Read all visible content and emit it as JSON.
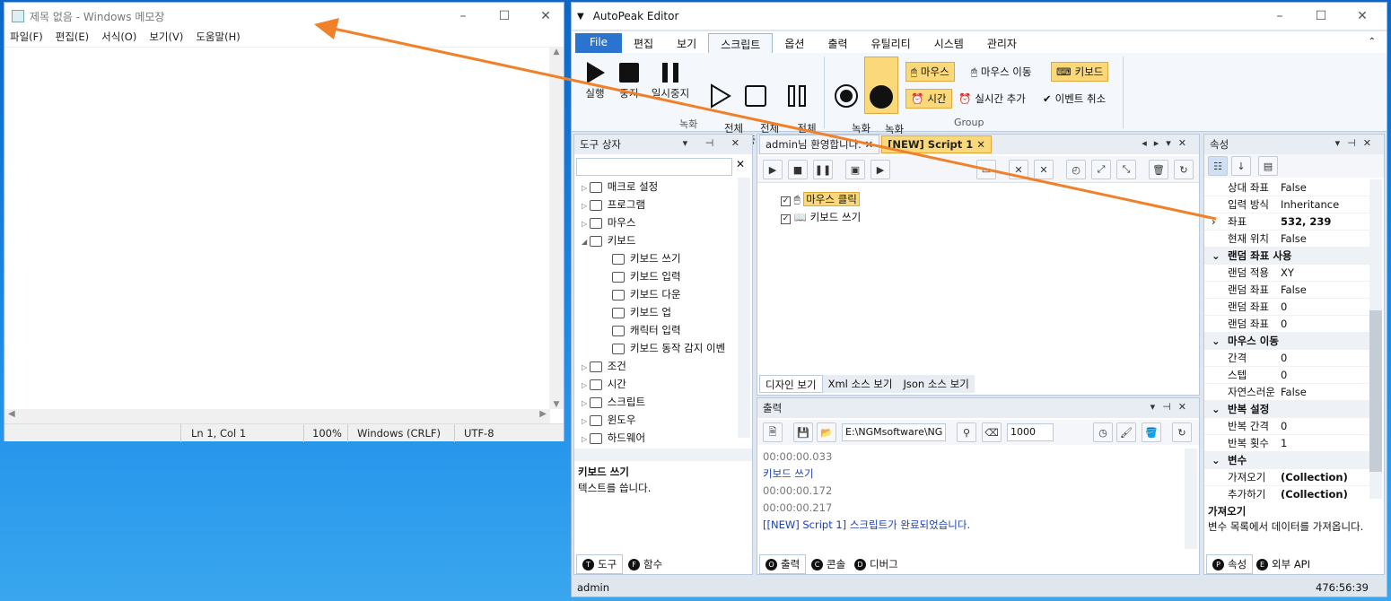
{
  "notepad": {
    "title": "제목 없음 - Windows 메모장",
    "menu": [
      "파일(F)",
      "편집(E)",
      "서식(O)",
      "보기(V)",
      "도움말(H)"
    ],
    "status": {
      "position": "Ln 1, Col 1",
      "zoom": "100%",
      "eol": "Windows (CRLF)",
      "encoding": "UTF-8"
    }
  },
  "editor": {
    "title": "AutoPeak Editor",
    "menu_tabs": [
      "File",
      "편집",
      "보기",
      "스크립트",
      "옵션",
      "출력",
      "유틸리티",
      "시스템",
      "관리자"
    ],
    "ribbon": {
      "run": "실행",
      "stop": "중지",
      "pause": "일시중지",
      "all_run": "전체\n실행",
      "all_stop": "전체\n중지",
      "all_pause": "전체\n일시중지",
      "rec_start": "녹화\n시작",
      "rec_stop": "녹화\n중지",
      "group_record": "녹화",
      "group_group": "Group",
      "chip_mouse": "마우스",
      "chip_mouse_move": "마우스 이동",
      "chip_keyboard": "키보드",
      "chip_time": "시간",
      "chip_realtime": "실시간 추가",
      "chip_cancel": "이벤트 취소"
    },
    "toolbox": {
      "title": "도구 상자",
      "items": [
        {
          "label": "매크로 설정",
          "level": 0
        },
        {
          "label": "프로그램",
          "level": 0
        },
        {
          "label": "마우스",
          "level": 0
        },
        {
          "label": "키보드",
          "level": 0
        },
        {
          "label": "키보드 쓰기",
          "level": 1
        },
        {
          "label": "키보드 입력",
          "level": 1
        },
        {
          "label": "키보드 다운",
          "level": 1
        },
        {
          "label": "키보드 업",
          "level": 1
        },
        {
          "label": "캐릭터 입력",
          "level": 1
        },
        {
          "label": "키보드 동작 감지 이벤",
          "level": 1
        },
        {
          "label": "조건",
          "level": 0
        },
        {
          "label": "시간",
          "level": 0
        },
        {
          "label": "스크립트",
          "level": 0
        },
        {
          "label": "윈도우",
          "level": 0
        },
        {
          "label": "하드웨어",
          "level": 0
        }
      ],
      "desc_title": "키보드 쓰기",
      "desc_text": "텍스트를 씁니다.",
      "tabs": [
        "도구",
        "함수"
      ]
    },
    "docs": {
      "tab1": "admin님 환영합니다.",
      "tab2": "[NEW] Script 1",
      "steps": [
        "마우스 클릭",
        "키보드 쓰기"
      ],
      "view_tabs": [
        "디자인 보기",
        "Xml 소스 보기",
        "Json 소스 보기"
      ]
    },
    "output": {
      "title": "출력",
      "path": "E:\\NGMsoftware\\NG",
      "count": "1000",
      "lines": [
        "00:00:00.033",
        "키보드 쓰기",
        "00:00:00.172",
        "00:00:00.217",
        "[[NEW] Script 1] 스크립트가 완료되었습니다."
      ],
      "tabs": [
        "출력",
        "콘솔",
        "디버그"
      ]
    },
    "props": {
      "title": "속성",
      "rows": [
        {
          "k": "상대 좌표",
          "v": "False",
          "cat": false
        },
        {
          "k": "입력 방식",
          "v": "Inheritance",
          "cat": false
        },
        {
          "k": "좌표",
          "v": "532, 239",
          "cat": false
        },
        {
          "k": "현재 위치",
          "v": "False",
          "cat": false
        },
        {
          "k": "랜덤 좌표 사용",
          "v": "",
          "cat": true
        },
        {
          "k": "랜덤 적용",
          "v": "XY",
          "cat": false
        },
        {
          "k": "랜덤 좌표",
          "v": "False",
          "cat": false
        },
        {
          "k": "랜덤 좌표",
          "v": "0",
          "cat": false
        },
        {
          "k": "랜덤 좌표",
          "v": "0",
          "cat": false
        },
        {
          "k": "마우스 이동",
          "v": "",
          "cat": true
        },
        {
          "k": "간격",
          "v": "0",
          "cat": false
        },
        {
          "k": "스텝",
          "v": "0",
          "cat": false
        },
        {
          "k": "자연스러운",
          "v": "False",
          "cat": false
        },
        {
          "k": "반복 설정",
          "v": "",
          "cat": true
        },
        {
          "k": "반복 간격",
          "v": "0",
          "cat": false
        },
        {
          "k": "반복 횟수",
          "v": "1",
          "cat": false
        },
        {
          "k": "변수",
          "v": "",
          "cat": true
        },
        {
          "k": "가져오기",
          "v": "(Collection)",
          "cat": false
        },
        {
          "k": "추가하기",
          "v": "(Collection)",
          "cat": false
        }
      ],
      "desc_title": "가져오기",
      "desc_text": "변수 목록에서 데이터를 가져옵니다.",
      "tabs": [
        "속성",
        "외부 API"
      ]
    },
    "status": {
      "user": "admin",
      "time": "476:56:39"
    }
  },
  "colors": {
    "accent": "#2a74d0",
    "highlight": "#fbd97a",
    "arrow": "#f0812a",
    "link_blue": "#1a3fb0"
  }
}
